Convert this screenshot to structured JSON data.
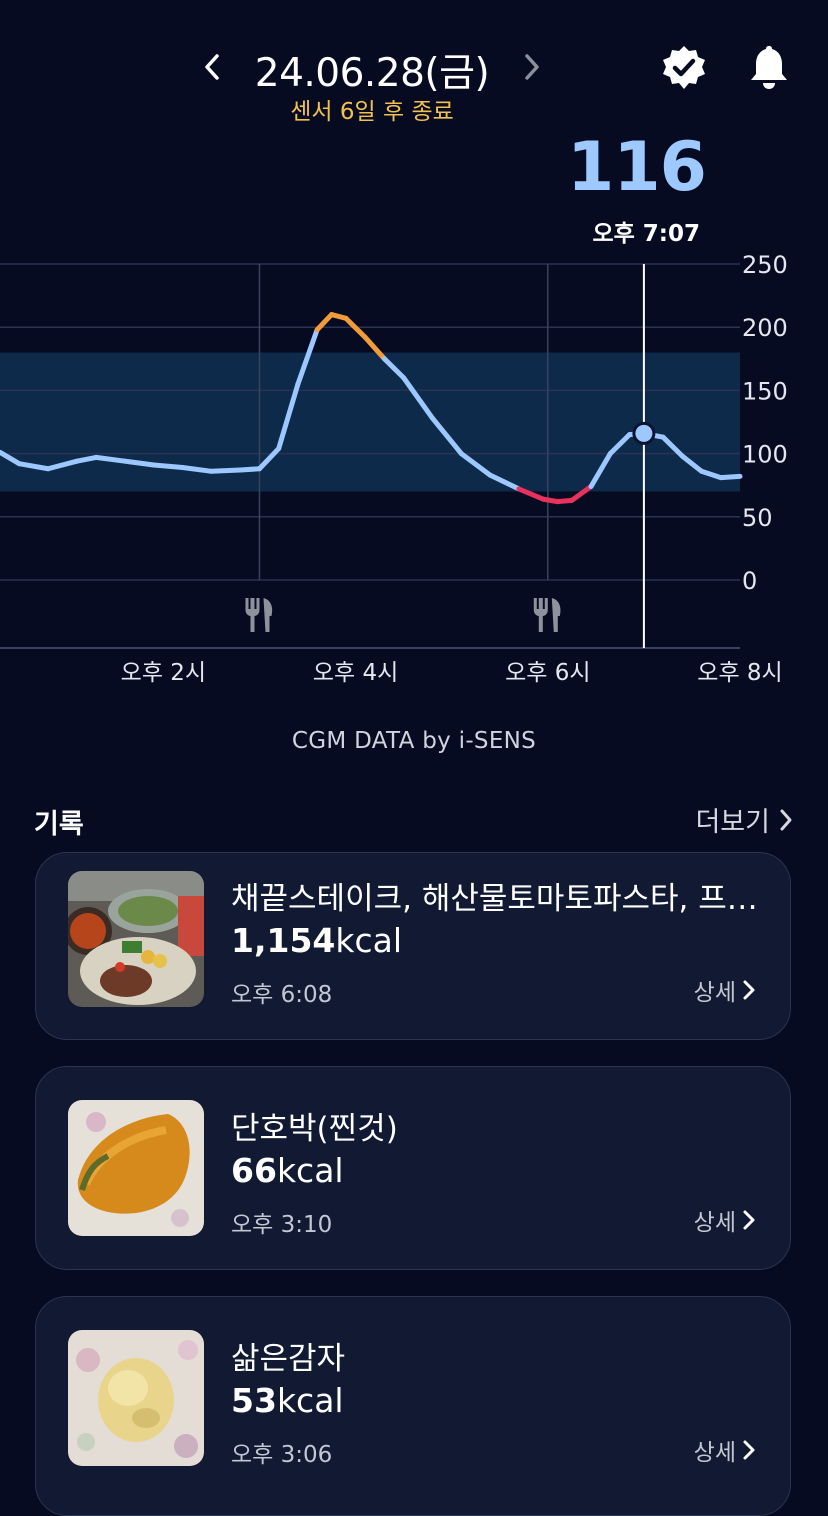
{
  "header": {
    "date": "24.06.28(금)",
    "sensor_status": "센서 6일 후 종료",
    "prev_icon": "chevron-left-icon",
    "next_icon": "chevron-right-icon",
    "verified_icon": "verified-badge-icon",
    "bell_icon": "bell-icon"
  },
  "current": {
    "value": "116",
    "time": "오후 7:07"
  },
  "chart_data": {
    "type": "line",
    "y_ticks": [
      "250",
      "200",
      "150",
      "100",
      "50",
      "0"
    ],
    "ylim": [
      0,
      250
    ],
    "target_range": [
      70,
      180
    ],
    "x_labels": [
      "오후 2시",
      "오후 4시",
      "오후 6시",
      "오후 8시"
    ],
    "x_label_hours": [
      14,
      16,
      18,
      20
    ],
    "xlim": [
      12.3,
      20.0
    ],
    "meal_markers_hours": [
      15.0,
      18.0
    ],
    "cursor_hour": 19.0,
    "cursor_value": 116,
    "series": [
      {
        "x": [
          12.3,
          12.5,
          12.8,
          13.1,
          13.3,
          13.6,
          13.9,
          14.2,
          14.5,
          14.8,
          15.0,
          15.2,
          15.4,
          15.6,
          15.75,
          15.9,
          16.1,
          16.3,
          16.5,
          16.8,
          17.1,
          17.4,
          17.7,
          17.95,
          18.1,
          18.25,
          18.45,
          18.65,
          18.85,
          19.0,
          19.2,
          19.4,
          19.6,
          19.8,
          20.0
        ],
        "y": [
          101,
          92,
          88,
          94,
          97,
          94,
          91,
          89,
          86,
          87,
          88,
          104,
          155,
          198,
          210,
          207,
          192,
          175,
          160,
          128,
          100,
          83,
          72,
          64,
          62,
          63,
          74,
          100,
          115,
          116,
          113,
          98,
          86,
          81,
          82
        ]
      }
    ],
    "colors": {
      "in_range": "#9dc7ff",
      "high": "#f29b3a",
      "low": "#e8325d",
      "band": "#0e2a4a"
    }
  },
  "credit": "CGM DATA by i-SENS",
  "records": {
    "title": "기록",
    "more": "더보기",
    "items": [
      {
        "name": "채끝스테이크, 해산물토마토파스타, 프렌치프라이",
        "kcal_value": "1,154",
        "kcal_unit": "kcal",
        "time": "오후 6:08",
        "detail": "상세"
      },
      {
        "name": "단호박(찐것)",
        "kcal_value": "66",
        "kcal_unit": "kcal",
        "time": "오후 3:10",
        "detail": "상세"
      },
      {
        "name": "삶은감자",
        "kcal_value": "53",
        "kcal_unit": "kcal",
        "time": "오후 3:06",
        "detail": "상세"
      }
    ]
  }
}
